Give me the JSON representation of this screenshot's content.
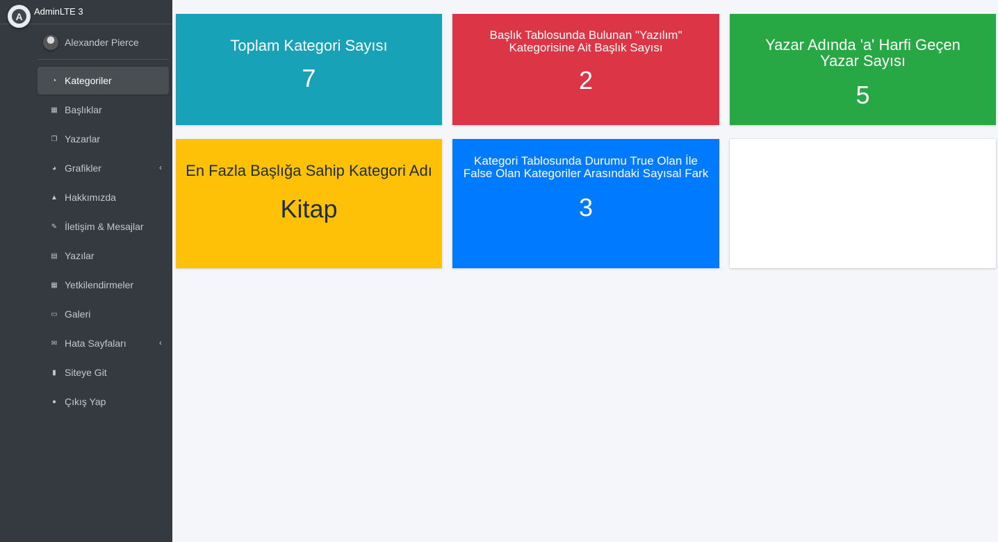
{
  "brand": {
    "name": "AdminLTE 3",
    "logo_letter": "A"
  },
  "user": {
    "name": "Alexander Pierce"
  },
  "sidebar": {
    "items": [
      {
        "label": "Kategoriler",
        "icon": "dashboard-icon",
        "glyph": "◔",
        "active": true
      },
      {
        "label": "Başlıklar",
        "icon": "grid-icon",
        "glyph": "▦"
      },
      {
        "label": "Yazarlar",
        "icon": "copy-icon",
        "glyph": "❐"
      },
      {
        "label": "Grafikler",
        "icon": "pie-chart-icon",
        "glyph": "◕",
        "arrow": "‹"
      },
      {
        "label": "Hakkımızda",
        "icon": "bell-icon",
        "glyph": "▲"
      },
      {
        "label": "İletişim & Mesajlar",
        "icon": "edit-icon",
        "glyph": "✎"
      },
      {
        "label": "Yazılar",
        "icon": "table-icon",
        "glyph": "▤"
      },
      {
        "label": "Yetkilendirmeler",
        "icon": "calendar-icon",
        "glyph": "▦"
      },
      {
        "label": "Galeri",
        "icon": "image-icon",
        "glyph": "▭"
      },
      {
        "label": "Hata Sayfaları",
        "icon": "envelope-icon",
        "glyph": "✉",
        "arrow": "‹"
      },
      {
        "label": "Siteye Git",
        "icon": "book-icon",
        "glyph": "▮"
      },
      {
        "label": "Çıkış Yap",
        "icon": "apple-icon",
        "glyph": "●"
      }
    ]
  },
  "cards": [
    {
      "title": "Toplam Kategori Sayısı",
      "value": "7",
      "color": "#17a2b8"
    },
    {
      "title": "Başlık Tablosunda Bulunan \"Yazılım\" Kategorisine Ait Başlık Sayısı",
      "value": "2",
      "color": "#dc3545"
    },
    {
      "title": "Yazar Adında 'a' Harfi Geçen Yazar Sayısı",
      "value": "5",
      "color": "#28a745"
    },
    {
      "title": "En Fazla Başlığa Sahip Kategori Adı",
      "value": "Kitap",
      "color": "#ffc107"
    },
    {
      "title": "Kategori Tablosunda Durumu True Olan İle False Olan Kategoriler Arasındaki Sayısal Fark",
      "value": "3",
      "color": "#007bff"
    },
    {
      "title": "",
      "value": "",
      "color": "#ffffff"
    }
  ],
  "colors": {
    "sidebar_bg": "#343a40",
    "content_bg": "#f4f6f9"
  }
}
